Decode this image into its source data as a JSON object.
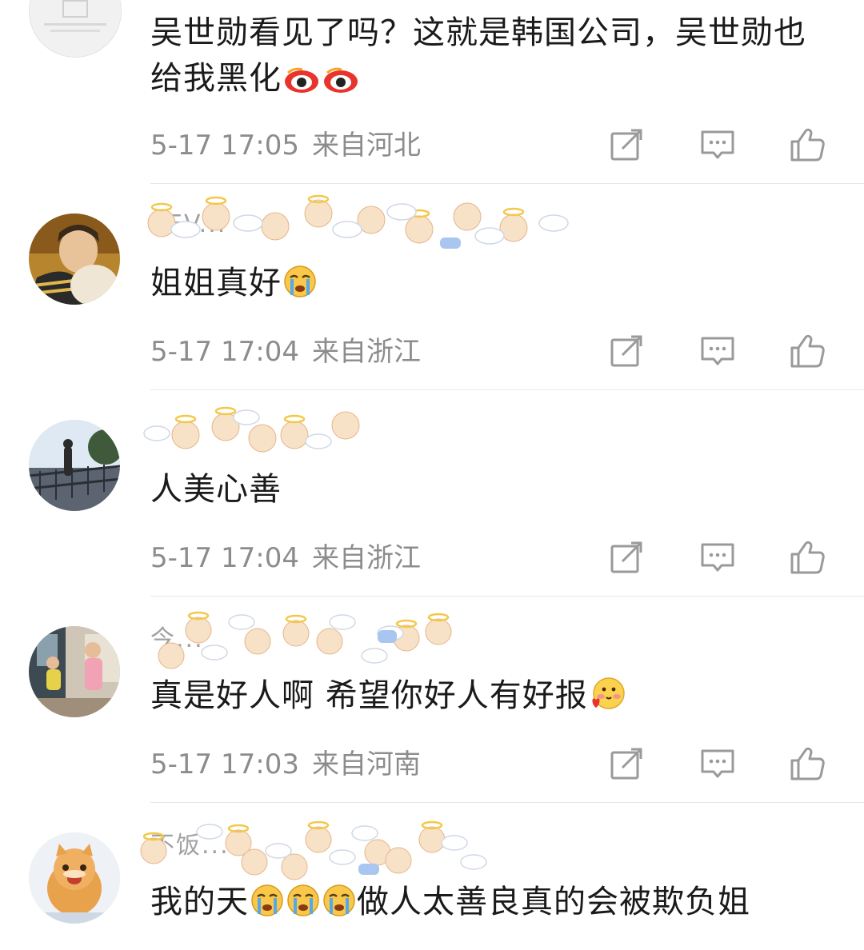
{
  "comments": [
    {
      "username": "",
      "content_text": "吴世勋看见了吗？这就是韩国公司，吴世勋也给我黑化",
      "content_emoji_count": 2,
      "time": "5-17 17:05",
      "location": "来自河北",
      "avatar_icon": "faded-text-avatar"
    },
    {
      "username": "SEV...",
      "content_text": "姐姐真好",
      "time": "5-17 17:04",
      "location": "来自浙江",
      "avatar_icon": "boy-with-doll-avatar"
    },
    {
      "username": "",
      "content_text": "人美心善",
      "time": "5-17 17:04",
      "location": "来自浙江",
      "avatar_icon": "evening-bridge-avatar"
    },
    {
      "username": "今...",
      "content_text": "真是好人啊 希望你好人有好报",
      "time": "5-17 17:03",
      "location": "来自河南",
      "avatar_icon": "kids-room-avatar"
    },
    {
      "username": "不饭...",
      "content_text": "我的天",
      "content_text_after": "做人太善良真的会被欺负姐",
      "time": "",
      "location": "",
      "avatar_icon": "orange-cat-avatar"
    }
  ],
  "icons": {
    "repost": "repost-icon",
    "comment": "comment-icon",
    "like": "like-icon"
  },
  "colors": {
    "meta_text": "#8c8c8c",
    "divider": "#e6e6e6",
    "icon_stroke": "#9a9a9a"
  }
}
